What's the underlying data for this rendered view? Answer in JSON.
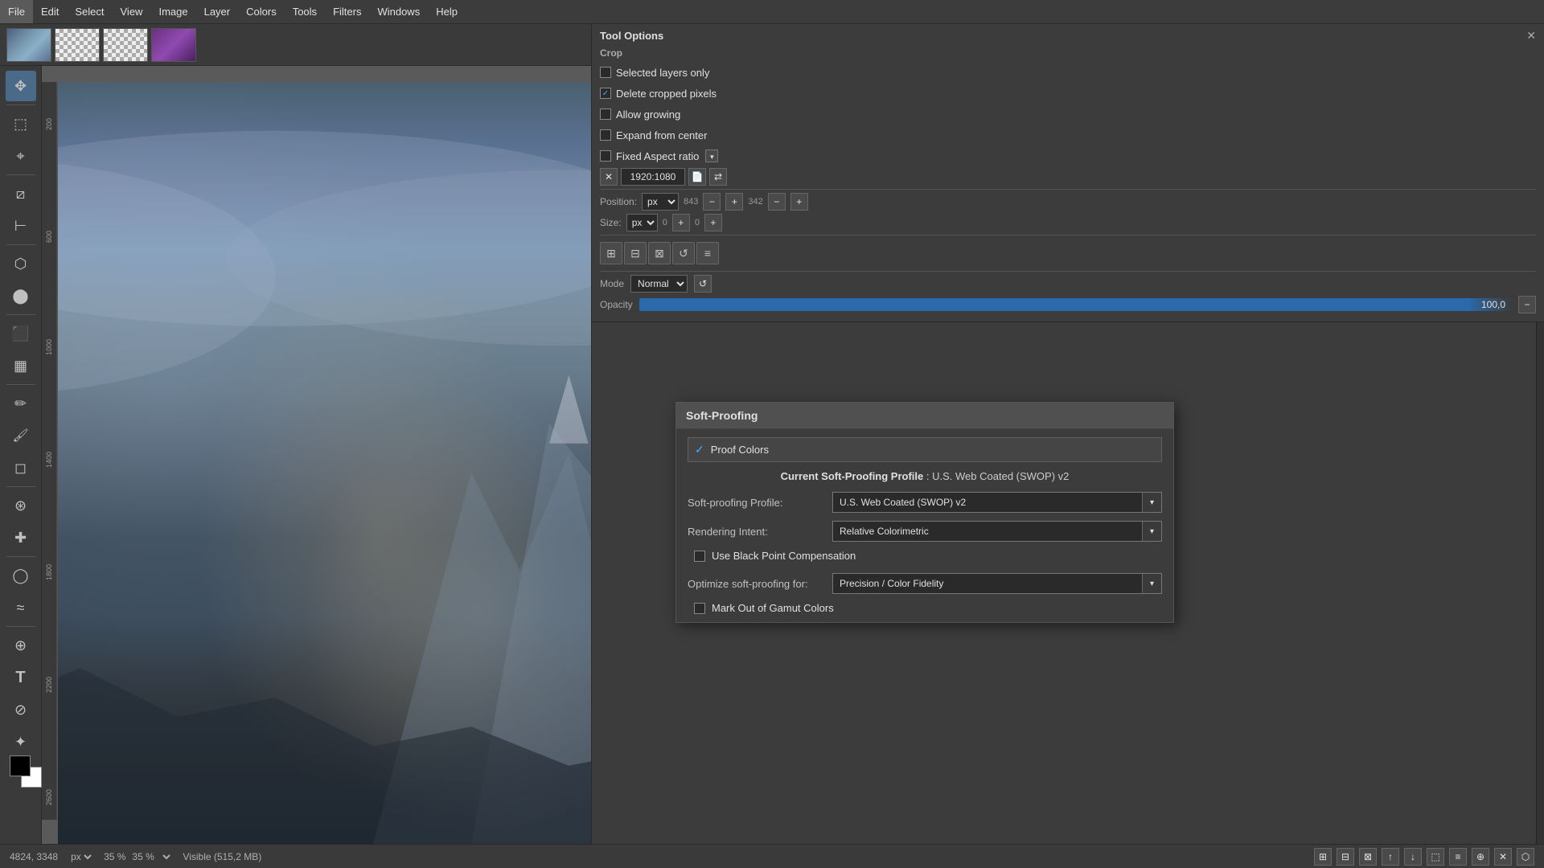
{
  "menubar": {
    "items": [
      "File",
      "Edit",
      "Select",
      "View",
      "Image",
      "Layer",
      "Colors",
      "Tools",
      "Filters",
      "Windows",
      "Help"
    ]
  },
  "toolbar_top": {
    "thumbnails": [
      {
        "type": "landscape",
        "label": "thumb1"
      },
      {
        "type": "checker",
        "label": "thumb2"
      },
      {
        "type": "checker-with-x",
        "label": "thumb3"
      },
      {
        "type": "purple",
        "label": "thumb4"
      }
    ]
  },
  "tool_options": {
    "title": "Tool Options",
    "section": "Crop",
    "selected_layers_only": "Selected layers only",
    "delete_cropped_pixels": "Delete cropped pixels",
    "allow_growing": "Allow growing",
    "expand_from_center": "Expand from center",
    "fixed_aspect_ratio": "Fixed Aspect ratio",
    "size_value": "1920:1080",
    "position_label": "Position:",
    "position_unit": "px",
    "pos_x": "843",
    "pos_y": "342",
    "size_label": "Size:",
    "size_unit": "px",
    "size_x": "0",
    "size_y": "0",
    "mode_label": "Mode",
    "mode_value": "Normal",
    "opacity_label": "Opacity",
    "opacity_value": "100,0"
  },
  "soft_proofing": {
    "title": "Soft-Proofing",
    "proof_colors_label": "Proof Colors",
    "current_profile_prefix": "Current Soft-Proofing Profile",
    "current_profile_value": "U.S. Web Coated (SWOP) v2",
    "soft_proofing_profile_label": "Soft-proofing Profile:",
    "soft_proofing_profile_value": "U.S. Web Coated (SWOP) v2",
    "rendering_intent_label": "Rendering Intent:",
    "rendering_intent_value": "Relative Colorimetric",
    "bpc_label": "Use Black Point Compensation",
    "optimize_label": "Optimize soft-proofing for:",
    "optimize_value": "Precision / Color Fidelity",
    "mark_gamut_label": "Mark Out of Gamut Colors",
    "precision_color_fidelity": "Precision Color Fidelity"
  },
  "statusbar": {
    "coordinates": "4824, 3348",
    "unit": "px",
    "zoom": "35 %",
    "visible_label": "Visible (515,2 MB)"
  },
  "icons": {
    "move": "✥",
    "rect_select": "⬚",
    "lasso": "⌖",
    "fuzzy": "⊞",
    "crop": "⧄",
    "measure": "⊢",
    "perspective": "⬡",
    "bucket": "⬛",
    "gradient": "▦",
    "pencil": "✏",
    "paintbrush": "🖌",
    "eraser": "◻",
    "clone": "⊛",
    "heal": "✚",
    "dodge": "◯",
    "smudge": "≈",
    "zoom": "⊕",
    "text": "T",
    "eyedropper": "⊘",
    "transform": "⬤",
    "paths": "✦"
  }
}
